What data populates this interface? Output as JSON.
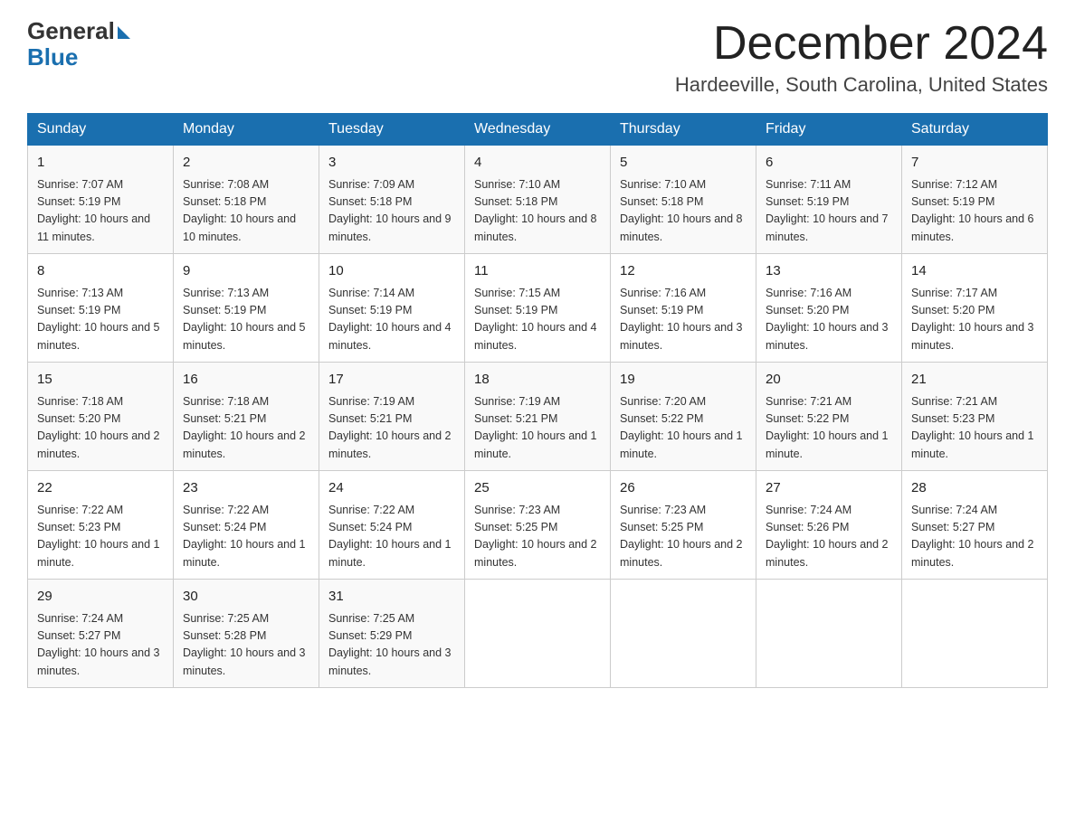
{
  "header": {
    "logo_general": "General",
    "logo_blue": "Blue",
    "month": "December 2024",
    "location": "Hardeeville, South Carolina, United States"
  },
  "days_of_week": [
    "Sunday",
    "Monday",
    "Tuesday",
    "Wednesday",
    "Thursday",
    "Friday",
    "Saturday"
  ],
  "weeks": [
    [
      {
        "day": "1",
        "sunrise": "7:07 AM",
        "sunset": "5:19 PM",
        "daylight": "10 hours and 11 minutes."
      },
      {
        "day": "2",
        "sunrise": "7:08 AM",
        "sunset": "5:18 PM",
        "daylight": "10 hours and 10 minutes."
      },
      {
        "day": "3",
        "sunrise": "7:09 AM",
        "sunset": "5:18 PM",
        "daylight": "10 hours and 9 minutes."
      },
      {
        "day": "4",
        "sunrise": "7:10 AM",
        "sunset": "5:18 PM",
        "daylight": "10 hours and 8 minutes."
      },
      {
        "day": "5",
        "sunrise": "7:10 AM",
        "sunset": "5:18 PM",
        "daylight": "10 hours and 8 minutes."
      },
      {
        "day": "6",
        "sunrise": "7:11 AM",
        "sunset": "5:19 PM",
        "daylight": "10 hours and 7 minutes."
      },
      {
        "day": "7",
        "sunrise": "7:12 AM",
        "sunset": "5:19 PM",
        "daylight": "10 hours and 6 minutes."
      }
    ],
    [
      {
        "day": "8",
        "sunrise": "7:13 AM",
        "sunset": "5:19 PM",
        "daylight": "10 hours and 5 minutes."
      },
      {
        "day": "9",
        "sunrise": "7:13 AM",
        "sunset": "5:19 PM",
        "daylight": "10 hours and 5 minutes."
      },
      {
        "day": "10",
        "sunrise": "7:14 AM",
        "sunset": "5:19 PM",
        "daylight": "10 hours and 4 minutes."
      },
      {
        "day": "11",
        "sunrise": "7:15 AM",
        "sunset": "5:19 PM",
        "daylight": "10 hours and 4 minutes."
      },
      {
        "day": "12",
        "sunrise": "7:16 AM",
        "sunset": "5:19 PM",
        "daylight": "10 hours and 3 minutes."
      },
      {
        "day": "13",
        "sunrise": "7:16 AM",
        "sunset": "5:20 PM",
        "daylight": "10 hours and 3 minutes."
      },
      {
        "day": "14",
        "sunrise": "7:17 AM",
        "sunset": "5:20 PM",
        "daylight": "10 hours and 3 minutes."
      }
    ],
    [
      {
        "day": "15",
        "sunrise": "7:18 AM",
        "sunset": "5:20 PM",
        "daylight": "10 hours and 2 minutes."
      },
      {
        "day": "16",
        "sunrise": "7:18 AM",
        "sunset": "5:21 PM",
        "daylight": "10 hours and 2 minutes."
      },
      {
        "day": "17",
        "sunrise": "7:19 AM",
        "sunset": "5:21 PM",
        "daylight": "10 hours and 2 minutes."
      },
      {
        "day": "18",
        "sunrise": "7:19 AM",
        "sunset": "5:21 PM",
        "daylight": "10 hours and 1 minute."
      },
      {
        "day": "19",
        "sunrise": "7:20 AM",
        "sunset": "5:22 PM",
        "daylight": "10 hours and 1 minute."
      },
      {
        "day": "20",
        "sunrise": "7:21 AM",
        "sunset": "5:22 PM",
        "daylight": "10 hours and 1 minute."
      },
      {
        "day": "21",
        "sunrise": "7:21 AM",
        "sunset": "5:23 PM",
        "daylight": "10 hours and 1 minute."
      }
    ],
    [
      {
        "day": "22",
        "sunrise": "7:22 AM",
        "sunset": "5:23 PM",
        "daylight": "10 hours and 1 minute."
      },
      {
        "day": "23",
        "sunrise": "7:22 AM",
        "sunset": "5:24 PM",
        "daylight": "10 hours and 1 minute."
      },
      {
        "day": "24",
        "sunrise": "7:22 AM",
        "sunset": "5:24 PM",
        "daylight": "10 hours and 1 minute."
      },
      {
        "day": "25",
        "sunrise": "7:23 AM",
        "sunset": "5:25 PM",
        "daylight": "10 hours and 2 minutes."
      },
      {
        "day": "26",
        "sunrise": "7:23 AM",
        "sunset": "5:25 PM",
        "daylight": "10 hours and 2 minutes."
      },
      {
        "day": "27",
        "sunrise": "7:24 AM",
        "sunset": "5:26 PM",
        "daylight": "10 hours and 2 minutes."
      },
      {
        "day": "28",
        "sunrise": "7:24 AM",
        "sunset": "5:27 PM",
        "daylight": "10 hours and 2 minutes."
      }
    ],
    [
      {
        "day": "29",
        "sunrise": "7:24 AM",
        "sunset": "5:27 PM",
        "daylight": "10 hours and 3 minutes."
      },
      {
        "day": "30",
        "sunrise": "7:25 AM",
        "sunset": "5:28 PM",
        "daylight": "10 hours and 3 minutes."
      },
      {
        "day": "31",
        "sunrise": "7:25 AM",
        "sunset": "5:29 PM",
        "daylight": "10 hours and 3 minutes."
      },
      null,
      null,
      null,
      null
    ]
  ],
  "labels": {
    "sunrise": "Sunrise:",
    "sunset": "Sunset:",
    "daylight": "Daylight:"
  }
}
